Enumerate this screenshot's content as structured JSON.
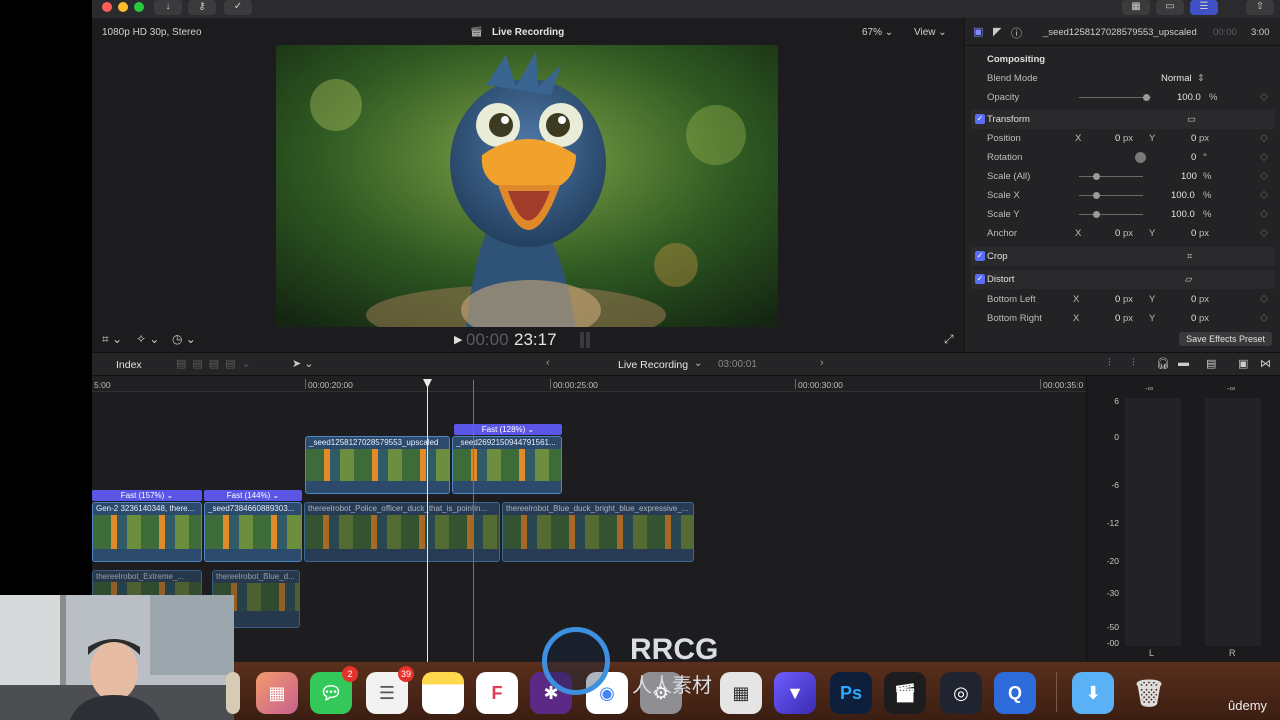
{
  "viewer": {
    "format": "1080p HD 30p, Stereo",
    "title": "Live Recording",
    "zoom": "67%",
    "view_menu": "View",
    "timecode_dim": "00:00",
    "timecode": "23:17"
  },
  "inspector": {
    "clip_name": "_seed1258127028579553_upscaled",
    "duration_dim": "00:00",
    "duration": "3:00",
    "compositing": "Compositing",
    "blend_mode_label": "Blend Mode",
    "blend_mode_value": "Normal",
    "opacity_label": "Opacity",
    "opacity_value": "100.0",
    "transform": "Transform",
    "position_label": "Position",
    "rotation_label": "Rotation",
    "rotation_value": "0",
    "scale_all_label": "Scale (All)",
    "scale_all_value": "100",
    "scale_x_label": "Scale X",
    "scale_x_value": "100.0",
    "scale_y_label": "Scale Y",
    "scale_y_value": "100.0",
    "anchor_label": "Anchor",
    "crop": "Crop",
    "distort": "Distort",
    "bottom_left_label": "Bottom Left",
    "bottom_right_label": "Bottom Right",
    "x": "X",
    "y": "Y",
    "zero": "0",
    "px": "px",
    "pct": "%",
    "deg": "°",
    "save_effects_preset": "Save Effects Preset"
  },
  "timeline_toolbar": {
    "index": "Index",
    "project": "Live Recording",
    "duration": "03:00:01"
  },
  "ruler": [
    "5:00",
    "00:00:20:00",
    "00:00:25:00",
    "00:00:30:00",
    "00:00:35:0"
  ],
  "clips": {
    "upper_retime": "Fast (128%)",
    "upper_a": "_seed1258127028579553_upscaled",
    "upper_b": "_seed2692150944791561...",
    "retime_a": "Fast (157%)",
    "retime_b": "Fast (144%)",
    "main_a": "Gen-2 3236140348, there...",
    "main_b": "_seed7384660889303...",
    "main_c": "thereelrobot_Police_officer_duck_that_is_pointin...",
    "main_d": "thereelrobot_Blue_duck_bright_blue_expressive_...",
    "lower_a": "thereelrobot_Extreme_...",
    "lower_b": "thereelrobot_Blue_d..."
  },
  "meters": {
    "scale": [
      "6",
      "0",
      "-6",
      "-12",
      "-20",
      "-30",
      "-50",
      "-00"
    ],
    "peak": "-∞",
    "left": "L",
    "right": "R"
  },
  "dock": {
    "messages_badge": "2",
    "reminders_badge": "39"
  },
  "watermark": {
    "brand": "RRCG",
    "subtitle": "人人素材",
    "corner": "ûdemy"
  }
}
